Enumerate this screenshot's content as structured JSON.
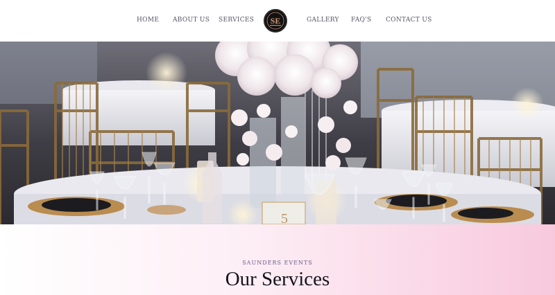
{
  "nav": {
    "items": [
      {
        "label": "HOME"
      },
      {
        "label": "ABOUT US"
      },
      {
        "label": "SERVICES"
      },
      {
        "label": "GALLERY"
      },
      {
        "label": "FAQ'S"
      },
      {
        "label": "CONTACT US"
      }
    ],
    "logo": {
      "monogram": "SE",
      "icon": "logo-icon"
    }
  },
  "hero": {
    "image": "banquet-table-setting",
    "table_number": "5"
  },
  "services": {
    "eyebrow": "SAUNDERS EVENTS",
    "title": "Our Services"
  },
  "colors": {
    "accent_pink": "#f8c9dd",
    "nav_text": "#555566",
    "title_text": "#14141c",
    "eyebrow_text": "#6a5a8a"
  }
}
